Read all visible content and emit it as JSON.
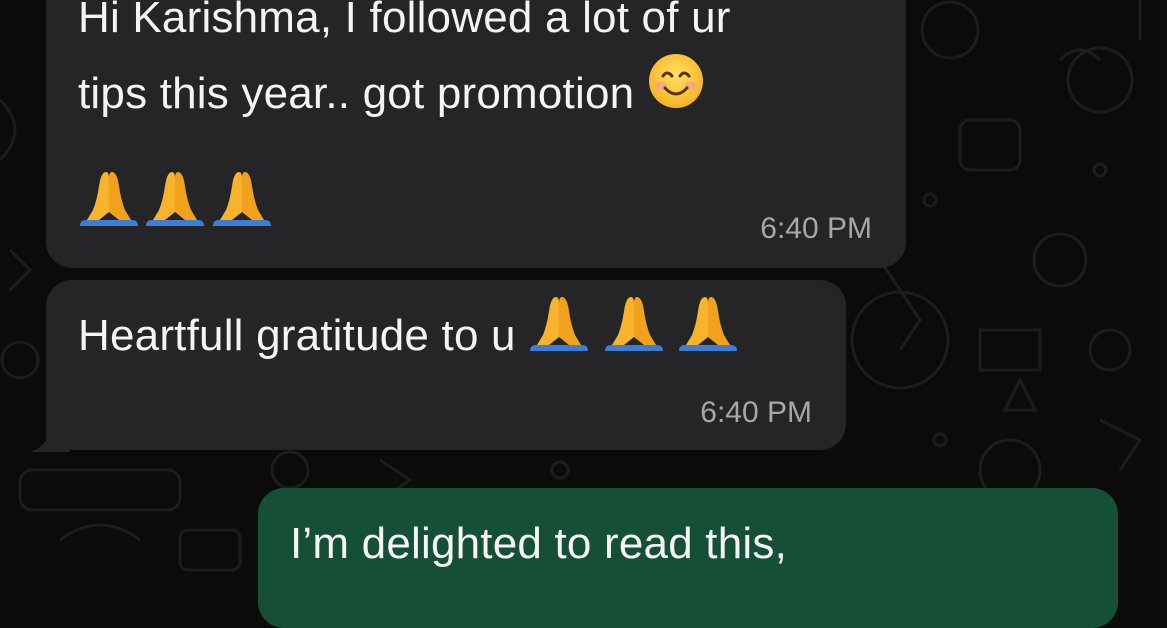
{
  "chat": {
    "messages": [
      {
        "direction": "incoming",
        "lines": [
          "Hi Karishma, I followed a lot of ur",
          "tips this year.. got promotion"
        ],
        "emojis_line2": [
          "smiling-face-icon"
        ],
        "emojis_line3": [
          "folded-hands-icon",
          "folded-hands-icon",
          "folded-hands-icon"
        ],
        "time": "6:40 PM"
      },
      {
        "direction": "incoming",
        "lines": [
          "Heartfull gratitude to u"
        ],
        "emojis_line1": [
          "folded-hands-icon",
          "folded-hands-icon",
          "folded-hands-icon"
        ],
        "time": "6:40 PM"
      },
      {
        "direction": "outgoing",
        "lines": [
          "I’m delighted to read this,"
        ]
      }
    ]
  },
  "colors": {
    "background": "#0b0b0b",
    "incoming_bubble": "#252527",
    "outgoing_bubble": "#164f37",
    "timestamp": "#a7a7a9"
  }
}
